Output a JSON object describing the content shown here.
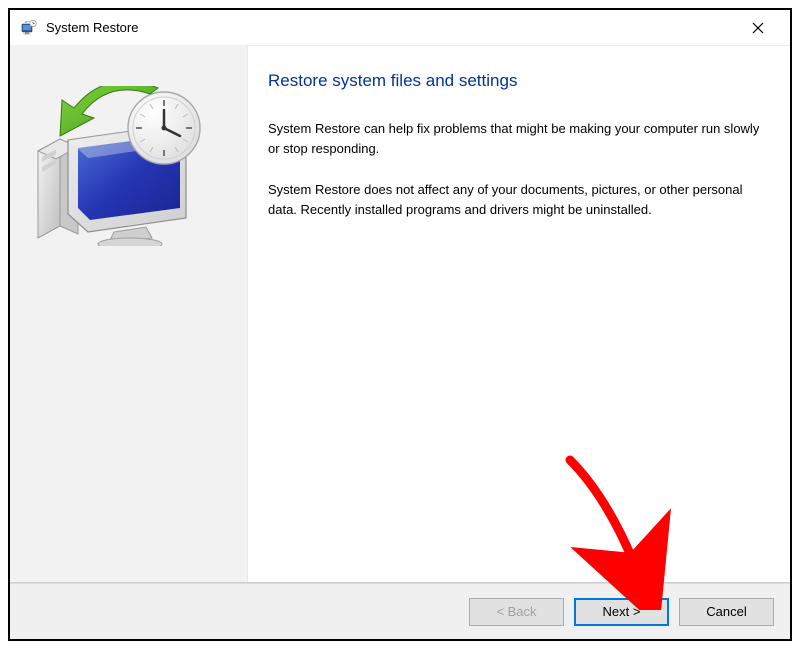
{
  "window": {
    "title": "System Restore"
  },
  "main": {
    "heading": "Restore system files and settings",
    "paragraph1": "System Restore can help fix problems that might be making your computer run slowly or stop responding.",
    "paragraph2": "System Restore does not affect any of your documents, pictures, or other personal data. Recently installed programs and drivers might be uninstalled."
  },
  "buttons": {
    "back": "< Back",
    "next": "Next >",
    "cancel": "Cancel"
  },
  "icons": {
    "app": "system-restore-app-icon",
    "close": "close-icon",
    "graphic": "system-restore-graphic"
  },
  "annotation": {
    "arrow_color": "#ff0000"
  }
}
